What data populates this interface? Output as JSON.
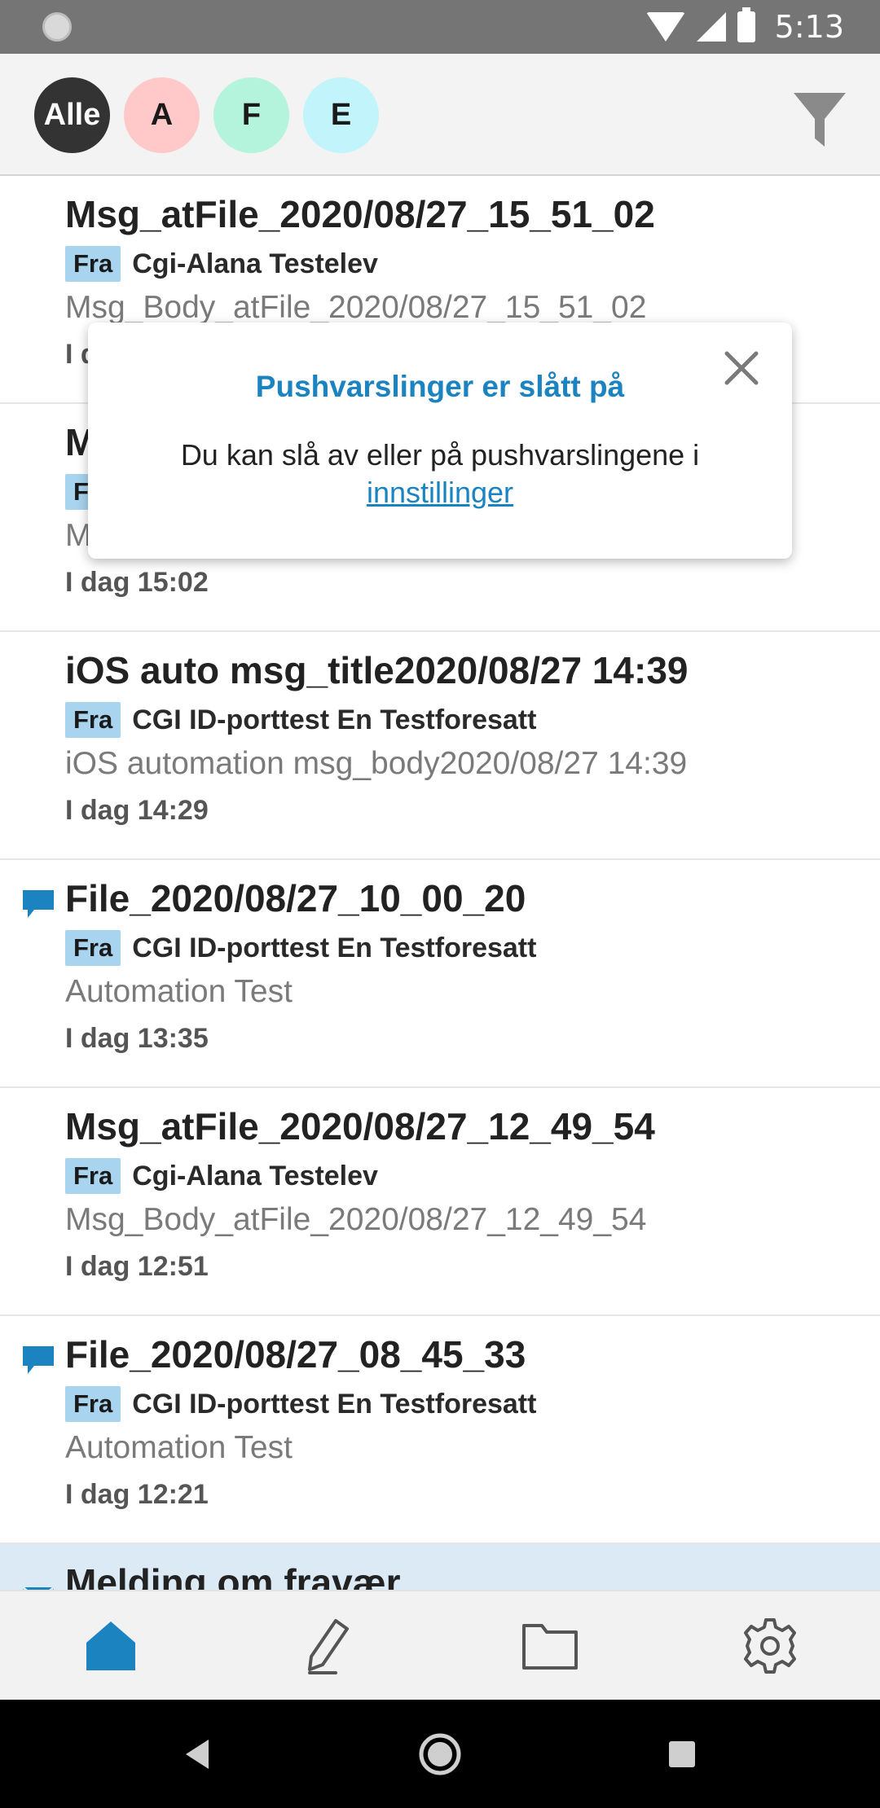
{
  "status_bar": {
    "time": "5:13"
  },
  "filters": [
    {
      "label": "Alle",
      "color": "#333333"
    },
    {
      "label": "A",
      "color": "#ffc9c9"
    },
    {
      "label": "F",
      "color": "#b4f3dc"
    },
    {
      "label": "E",
      "color": "#c2f4fb"
    }
  ],
  "from_label": "Fra",
  "messages": [
    {
      "title": "Msg_atFile_2020/08/27_15_51_02",
      "sender": "Cgi-Alana Testelev",
      "body": "Msg_Body_atFile_2020/08/27_15_51_02",
      "time": "I dag",
      "icon": ""
    },
    {
      "title": "M",
      "sender": "",
      "body": "M",
      "time": "I dag 15:02",
      "icon": ""
    },
    {
      "title": "iOS auto msg_title2020/08/27 14:39",
      "sender": "CGI ID-porttest En Testforesatt",
      "body": "iOS automation msg_body2020/08/27 14:39",
      "time": "I dag 14:29",
      "icon": ""
    },
    {
      "title": "File_2020/08/27_10_00_20",
      "sender": "CGI ID-porttest En Testforesatt",
      "body": "Automation Test",
      "time": "I dag 13:35",
      "icon": "chat-bubble-icon"
    },
    {
      "title": "Msg_atFile_2020/08/27_12_49_54",
      "sender": "Cgi-Alana Testelev",
      "body": "Msg_Body_atFile_2020/08/27_12_49_54",
      "time": "I dag 12:51",
      "icon": ""
    },
    {
      "title": "File_2020/08/27_08_45_33",
      "sender": "CGI ID-porttest En Testforesatt",
      "body": "Automation Test",
      "time": "I dag 12:21",
      "icon": "chat-bubble-icon"
    },
    {
      "title": "Melding om fravær",
      "sender": "",
      "body": "",
      "time": "",
      "icon": "envelope-icon"
    }
  ],
  "popup": {
    "title": "Pushvarslinger er slått på",
    "text": "Du kan slå av eller på pushvarslingene i",
    "link": "innstillinger"
  },
  "bottom_nav": [
    "home-icon",
    "compose-icon",
    "folder-icon",
    "settings-icon"
  ],
  "colors": {
    "accent": "#1b83c0",
    "badge": "#a8d4ef",
    "highlight_row": "#dbeaf5"
  }
}
